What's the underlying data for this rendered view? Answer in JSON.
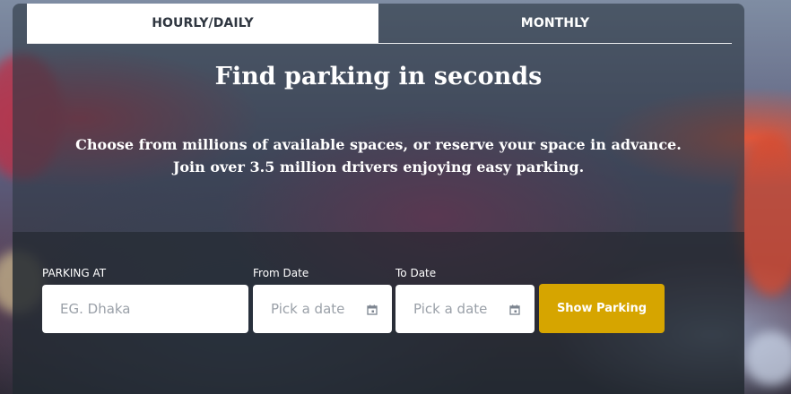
{
  "tabs": [
    {
      "label": "HOURLY/DAILY",
      "active": true
    },
    {
      "label": "MONTHLY",
      "active": false
    }
  ],
  "hero": {
    "title": "Find parking in seconds",
    "subtitle_line1": "Choose from millions of available spaces, or reserve your space in advance.",
    "subtitle_line2": "Join over 3.5 million drivers enjoying easy parking."
  },
  "form": {
    "parking_at_label": "PARKING AT",
    "parking_at_placeholder": "EG. Dhaka",
    "from_date_label": "From Date",
    "from_date_placeholder": "Pick a date",
    "to_date_label": "To Date",
    "to_date_placeholder": "Pick a date",
    "submit_label": "Show Parking"
  },
  "colors": {
    "accent": "#d6a500",
    "panel": "#2c3742",
    "active_tab": "#ffffff"
  }
}
